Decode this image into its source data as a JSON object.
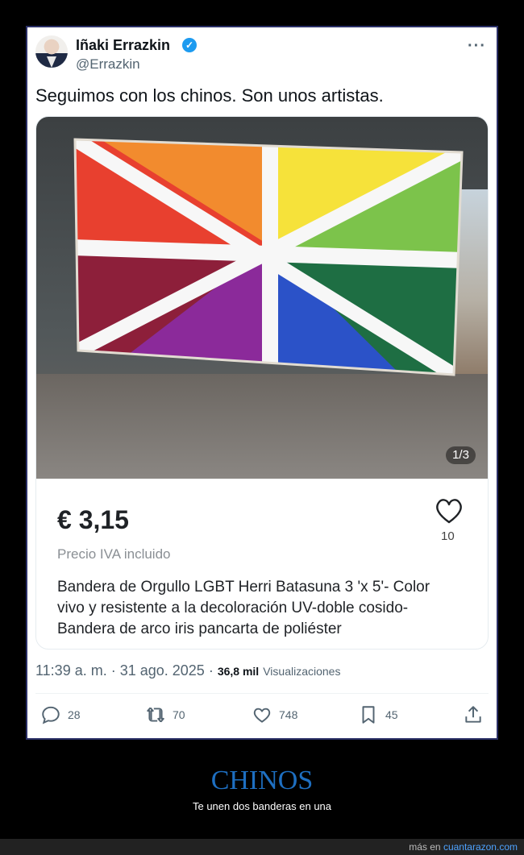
{
  "tweet": {
    "author_name": "Iñaki Errazkin",
    "handle": "@Errazkin",
    "text": "Seguimos con los chinos. Son unos artistas.",
    "image_counter": "1/3",
    "card": {
      "price": "€ 3,15",
      "like_count": "10",
      "vat_note": "Precio IVA incluido",
      "description": "Bandera de Orgullo LGBT Herri Batasuna 3 'x 5'- Color vivo y resistente a la decoloración UV-doble cosido-Bandera de arco iris pancarta de poliéster"
    },
    "time": "11:39 a. m. · 31 ago. 2025 ·",
    "views": "36,8 mil",
    "views_label": "Visualizaciones",
    "actions": {
      "replies": "28",
      "reposts": "70",
      "likes": "748",
      "bookmarks": "45"
    }
  },
  "caption": {
    "title": "CHINOS",
    "subtitle": "Te unen dos banderas en una"
  },
  "footer": {
    "prefix": "más en",
    "site": "cuantarazon.com"
  },
  "colors": {
    "flag_red": "#e8402f",
    "flag_orange": "#f28b2e",
    "flag_yellow": "#f6e23a",
    "flag_green": "#7cc34b",
    "flag_darkgreen": "#1e6e43",
    "flag_blue": "#2b52c8",
    "flag_purple": "#8b2a9a",
    "flag_maroon": "#8d1f3a",
    "accent_blue": "#1d9bf0",
    "caption_blue": "#1e6fc1"
  }
}
